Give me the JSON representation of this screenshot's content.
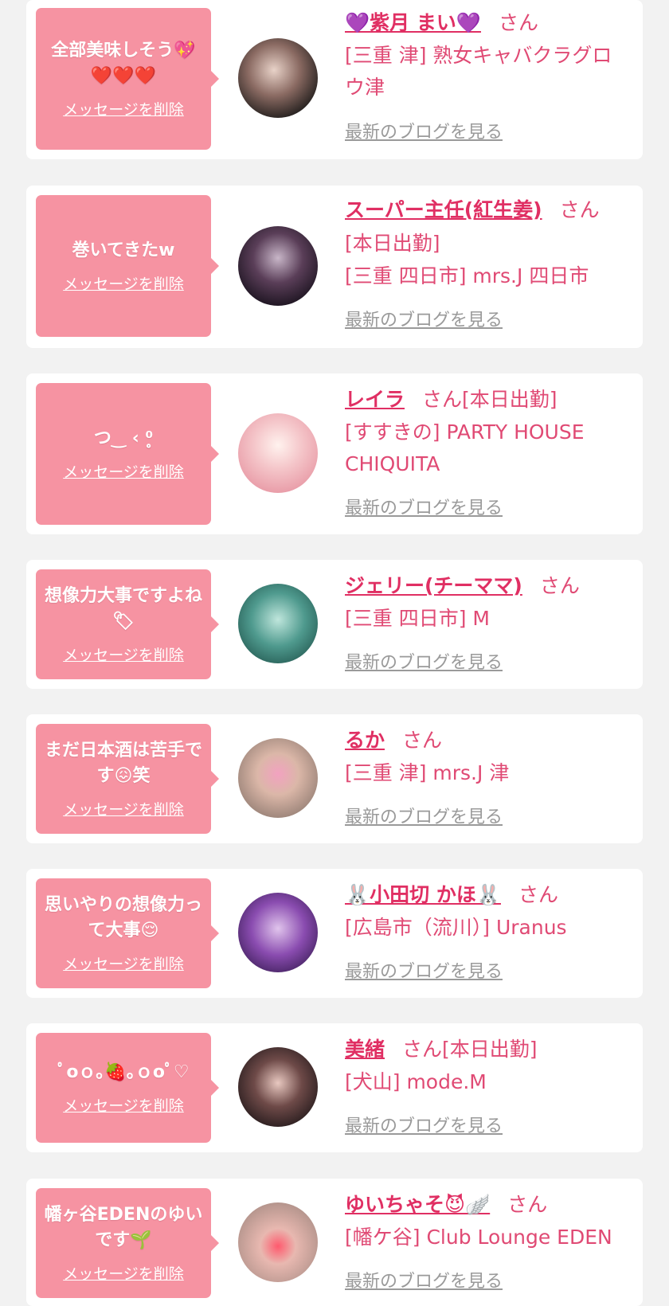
{
  "colors": {
    "accent": "#e02f63",
    "bubble": "#f693a2",
    "link_gray": "#9a9a9a",
    "background": "#f2f2f2"
  },
  "delete_label": "メッセージを削除",
  "blog_label": "最新のブログを見る",
  "items": [
    {
      "message": "全部美味しそう💖❤️❤️❤️",
      "name": "💜紫月 まい💜",
      "suffix": "さん",
      "shop": "[三重 津] 熟女キャバクラグロウ津"
    },
    {
      "message": "巻いてきたw",
      "name": "スーパー主任(紅生姜)",
      "suffix": "さん[本日出勤]",
      "shop": "[三重 四日市] mrs.J 四日市"
    },
    {
      "message": "つ‿ ‹ ⁰̥̥",
      "name": "レイラ",
      "suffix": "さん[本日出勤]",
      "shop": "[すすきの] PARTY HOUSE CHIQUITA"
    },
    {
      "message": "想像力大事ですよね🏷",
      "name": "ジェリー(チーママ)",
      "suffix": "さん",
      "shop": "[三重 四日市] M"
    },
    {
      "message": "まだ日本酒は苦手です😖笑",
      "name": "るか",
      "suffix": "さん",
      "shop": "[三重 津] mrs.J 津"
    },
    {
      "message": "思いやりの想像力って大事😌",
      "name": "🐰小田切 かほ🐰",
      "suffix": "さん",
      "shop": "[広島市（流川）] Uranus"
    },
    {
      "message": "ﾟoｏ｡🍓｡ｏoﾟ♡",
      "name": "美緒",
      "suffix": "さん[本日出勤]",
      "shop": "[犬山] mode.M"
    },
    {
      "message": "幡ヶ谷EDENのゆいです🌱",
      "name": "ゆいちゃそ😈🪽",
      "suffix": "さん",
      "shop": "[幡ケ谷] Club Lounge EDEN"
    }
  ]
}
